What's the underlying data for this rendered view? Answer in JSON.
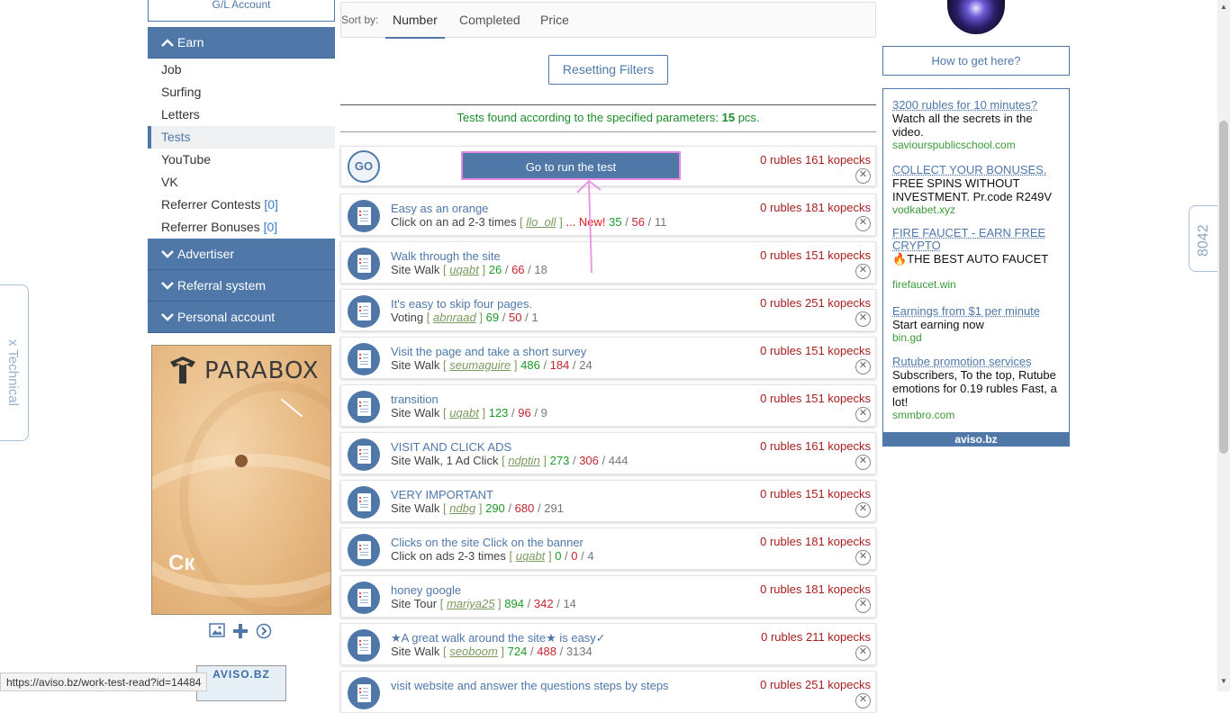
{
  "sidebar": {
    "gl_account": "G/L Account",
    "earn_label": "Earn",
    "items": [
      {
        "label": "Job",
        "count": ""
      },
      {
        "label": "Surfing",
        "count": ""
      },
      {
        "label": "Letters",
        "count": ""
      },
      {
        "label": "Tests",
        "count": ""
      },
      {
        "label": "YouTube",
        "count": ""
      },
      {
        "label": "VK",
        "count": ""
      },
      {
        "label": "Referrer Contests",
        "count": "[0]"
      },
      {
        "label": "Referrer Bonuses",
        "count": "[0]"
      }
    ],
    "active_item": "Tests",
    "sections": [
      "Advertiser",
      "Referral system",
      "Personal account"
    ],
    "banner_brand": "PARABOX",
    "banner_corner": "Ск",
    "mini_logo": "AVISO.BZ"
  },
  "toolbar": {
    "sort_label": "Sort by:",
    "tabs": [
      "Number",
      "Completed",
      "Price"
    ],
    "active_tab": "Number",
    "reset_label": "Resetting Filters"
  },
  "found": {
    "prefix": "Tests found according to the specified parameters:",
    "count": "15",
    "suffix": "pcs."
  },
  "featured": {
    "icon_text": "GO",
    "run_label": "Go to run the test",
    "price": "0 rubles 161 kopecks"
  },
  "tests": [
    {
      "title": "Easy as an orange",
      "type": "Click on an ad 2-3 times",
      "author": "llo_oll",
      "new": "... New!",
      "done": "35",
      "fail": "56",
      "pending": "11",
      "price": "0 rubles 181 kopecks"
    },
    {
      "title": "Walk through the site",
      "type": "Site Walk",
      "author": "uqabt",
      "new": "",
      "done": "26",
      "fail": "66",
      "pending": "18",
      "price": "0 rubles 151 kopecks"
    },
    {
      "title": "It's easy to skip four pages.",
      "type": "Voting",
      "author": "abnraad",
      "new": "",
      "done": "69",
      "fail": "50",
      "pending": "1",
      "price": "0 rubles 251 kopecks"
    },
    {
      "title": "Visit the page and take a short survey",
      "type": "Site Walk",
      "author": "seumaguire",
      "new": "",
      "done": "486",
      "fail": "184",
      "pending": "24",
      "price": "0 rubles 151 kopecks"
    },
    {
      "title": "transition",
      "type": "Site Walk",
      "author": "uqabt",
      "new": "",
      "done": "123",
      "fail": "96",
      "pending": "9",
      "price": "0 rubles 151 kopecks"
    },
    {
      "title": "VISIT AND CLICK ADS",
      "type": "Site Walk, 1 Ad Click",
      "author": "ndptin",
      "new": "",
      "done": "273",
      "fail": "306",
      "pending": "444",
      "price": "0 rubles 161 kopecks"
    },
    {
      "title": "VERY IMPORTANT",
      "type": "Site Walk",
      "author": "ndbg",
      "new": "",
      "done": "290",
      "fail": "680",
      "pending": "291",
      "price": "0 rubles 151 kopecks"
    },
    {
      "title": "Clicks on the site Click on the banner",
      "type": "Click on ads 2-3 times",
      "author": "uqabt",
      "new": "",
      "done": "0",
      "fail": "0",
      "pending": "4",
      "price": "0 rubles 181 kopecks"
    },
    {
      "title": "honey google",
      "type": "Site Tour",
      "author": "mariya25",
      "new": "",
      "done": "894",
      "fail": "342",
      "pending": "14",
      "price": "0 rubles 181 kopecks"
    },
    {
      "title": "★A great walk around the site★ is easy✓",
      "type": "Site Walk",
      "author": "seoboom",
      "new": "",
      "done": "724",
      "fail": "488",
      "pending": "3134",
      "price": "0 rubles 211 kopecks"
    },
    {
      "title": "visit website and answer the questions steps by steps",
      "type": "",
      "author": "",
      "new": "",
      "done": "",
      "fail": "",
      "pending": "",
      "price": "0 rubles 251 kopecks"
    }
  ],
  "right": {
    "how_label": "How to get here?",
    "ads": [
      {
        "title": "3200 rubles for 10 minutes?",
        "desc": "Watch all the secrets in the video.",
        "url": "saviourspublicschool.com"
      },
      {
        "title": "COLLECT YOUR BONUSES.",
        "desc": "FREE SPINS WITHOUT INVESTMENT. Pr.code R249V",
        "url": "vodkabet.xyz"
      },
      {
        "title": "FIRE FAUCET - EARN FREE CRYPTO",
        "desc": "THE BEST AUTO FAUCET",
        "url": "firefaucet.win"
      },
      {
        "title": "Earnings from $1 per minute",
        "desc": "Start earning now",
        "url": "bin.gd"
      },
      {
        "title": "Rutube promotion services",
        "desc": "Subscribers, To the top, Rutube emotions for 0.19 rubles Fast, a lot!",
        "url": "smmbro.com"
      }
    ],
    "footer": "aviso.bz"
  },
  "floating": {
    "technical": "x Technical",
    "side_tag": "8042"
  },
  "statusbar": "https://aviso.bz/work-test-read?id=14484",
  "colors": {
    "accent": "#4f78a8",
    "green": "#1c9a2a",
    "red": "#c1272d",
    "price": "#a51e1e",
    "highlight": "#e68ae2"
  }
}
